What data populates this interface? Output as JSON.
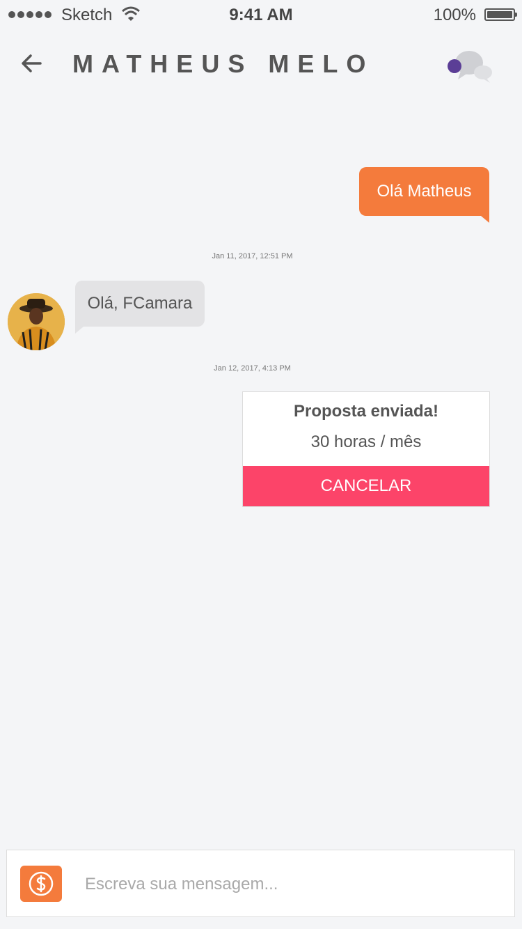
{
  "status_bar": {
    "carrier": "Sketch",
    "time": "9:41 AM",
    "battery_percent": "100%"
  },
  "header": {
    "title": "MATHEUS MELO",
    "back_icon": "arrow-left-icon",
    "chat_icon": "chat-bubbles-icon",
    "chat_badge_color": "#5b3e96"
  },
  "messages": [
    {
      "direction": "outgoing",
      "text": "Olá Matheus"
    },
    {
      "timestamp": "Jan 11, 2017, 12:51 PM"
    },
    {
      "direction": "incoming",
      "text": "Olá, FCamara",
      "avatar": "avatar-photo"
    },
    {
      "timestamp": "Jan 12, 2017, 4:13 PM"
    }
  ],
  "proposal": {
    "title": "Proposta enviada!",
    "detail": "30 horas / mês",
    "cancel_label": "CANCELAR"
  },
  "composer": {
    "placeholder": "Escreva sua mensagem...",
    "money_icon": "dollar-icon"
  },
  "colors": {
    "accent_orange": "#f47b3c",
    "cancel_red": "#fc4469",
    "incoming_bubble": "#e3e3e5",
    "background": "#f4f5f7"
  }
}
